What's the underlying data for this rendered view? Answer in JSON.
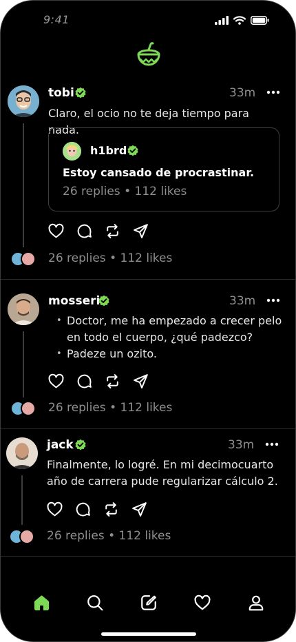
{
  "status_bar": {
    "time": "9:41"
  },
  "posts": [
    {
      "username": "tobi",
      "time_ago": "33m",
      "text": "Claro, el ocio no te deja tiempo para nada.",
      "quote": {
        "username": "h1brd",
        "text": "Estoy cansado de procrastinar.",
        "stats": "26 replies • 112 likes"
      },
      "stats": "26 replies • 112 likes"
    },
    {
      "username": "mosseri",
      "time_ago": "33m",
      "bullets": [
        "Doctor, me ha empezado a crecer pelo en todo el cuerpo, ¿qué padezco?",
        "Padeze un ozito."
      ],
      "stats": "26 replies • 112 likes"
    },
    {
      "username": "jack",
      "time_ago": "33m",
      "text": "Finalmente, lo logré. En mi decimocuarto año de carrera pude regularizar cálculo 2.",
      "stats": "26 replies • 112 likes"
    }
  ],
  "tab_bar": {
    "tabs": [
      "home-icon",
      "search-icon",
      "compose-icon",
      "heart-icon",
      "profile-icon"
    ],
    "active": "home-icon"
  },
  "colors": {
    "accent": "#7ed957",
    "background": "#000000",
    "muted": "#8e8e8e"
  }
}
